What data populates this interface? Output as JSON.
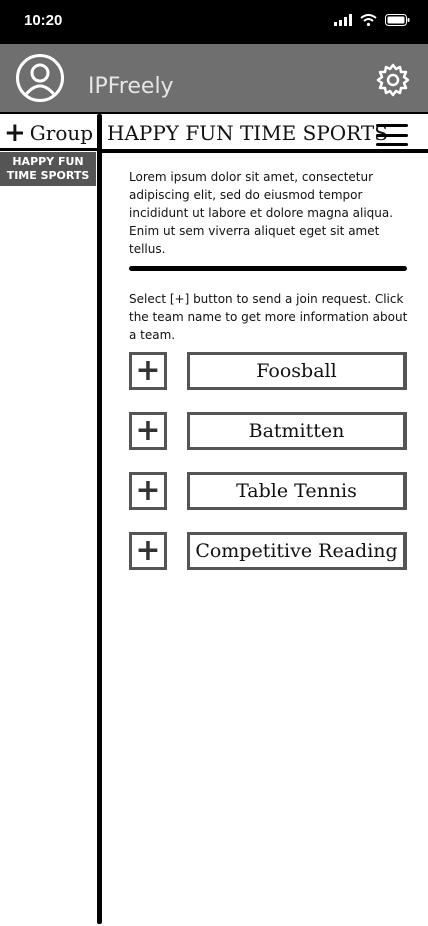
{
  "status": {
    "time": "10:20"
  },
  "header": {
    "username": "IPFreely"
  },
  "sidebar": {
    "add_group_label": "Group",
    "groups": [
      "HAPPY FUN TIME SPORTS"
    ]
  },
  "main": {
    "title": "HAPPY FUN TIME SPORTS",
    "description": "Lorem ipsum dolor sit amet, consectetur adipiscing elit, sed do eiusmod tempor incididunt ut labore et dolore magna aliqua. Enim ut sem viverra aliquet eget sit amet tellus.",
    "instructions": "Select [+] button to send a join request. Click the team name to get more information about a team.",
    "teams": [
      {
        "name": "Foosball"
      },
      {
        "name": "Batmitten"
      },
      {
        "name": "Table Tennis"
      },
      {
        "name": "Competitive Reading"
      }
    ],
    "add_symbol": "+"
  },
  "colors": {
    "header_bg": "#6f6f6f",
    "status_bg": "#000000",
    "group_item_bg": "#555555"
  }
}
